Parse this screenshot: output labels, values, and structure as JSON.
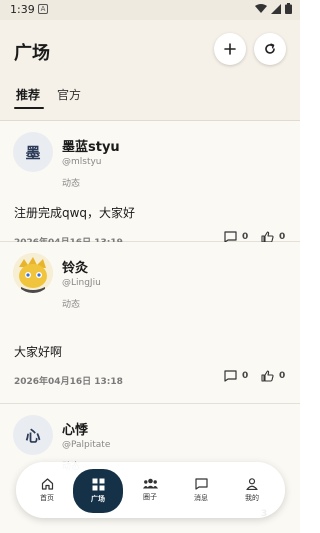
{
  "status_bar": {
    "time": "1:39",
    "notif_letter": "A"
  },
  "header": {
    "title": "广场",
    "tabs": [
      {
        "label": "推荐",
        "active": true
      },
      {
        "label": "官方",
        "active": false
      }
    ]
  },
  "posts": [
    {
      "avatar_text": "墨",
      "name": "墨蓝styu",
      "handle": "@mlstyu",
      "type": "动态",
      "content": "注册完成qwq，大家好",
      "time": "2026年04月16日 13:19",
      "comments": "0",
      "likes": "0"
    },
    {
      "avatar_text": "",
      "name": "铃灸",
      "handle": "@LingJiu",
      "type": "动态",
      "content": "大家好啊",
      "time": "2026年04月16日 13:18",
      "comments": "0",
      "likes": "0"
    },
    {
      "avatar_text": "心",
      "name": "心悸",
      "handle": "@Palpitate",
      "type": "动态",
      "content": "",
      "time": "",
      "comments": "",
      "likes": "3"
    }
  ],
  "bottom_nav": {
    "items": [
      {
        "label": "首页",
        "icon": "home-icon",
        "active": false
      },
      {
        "label": "广场",
        "icon": "grid-icon",
        "active": true
      },
      {
        "label": "圈子",
        "icon": "people-icon",
        "active": false
      },
      {
        "label": "消息",
        "icon": "message-icon",
        "active": false
      },
      {
        "label": "我的",
        "icon": "person-icon",
        "active": false
      }
    ]
  },
  "colors": {
    "header_bg": "#f5f1e8",
    "nav_active": "#143147",
    "feed_bg": "#f8f5ef"
  }
}
